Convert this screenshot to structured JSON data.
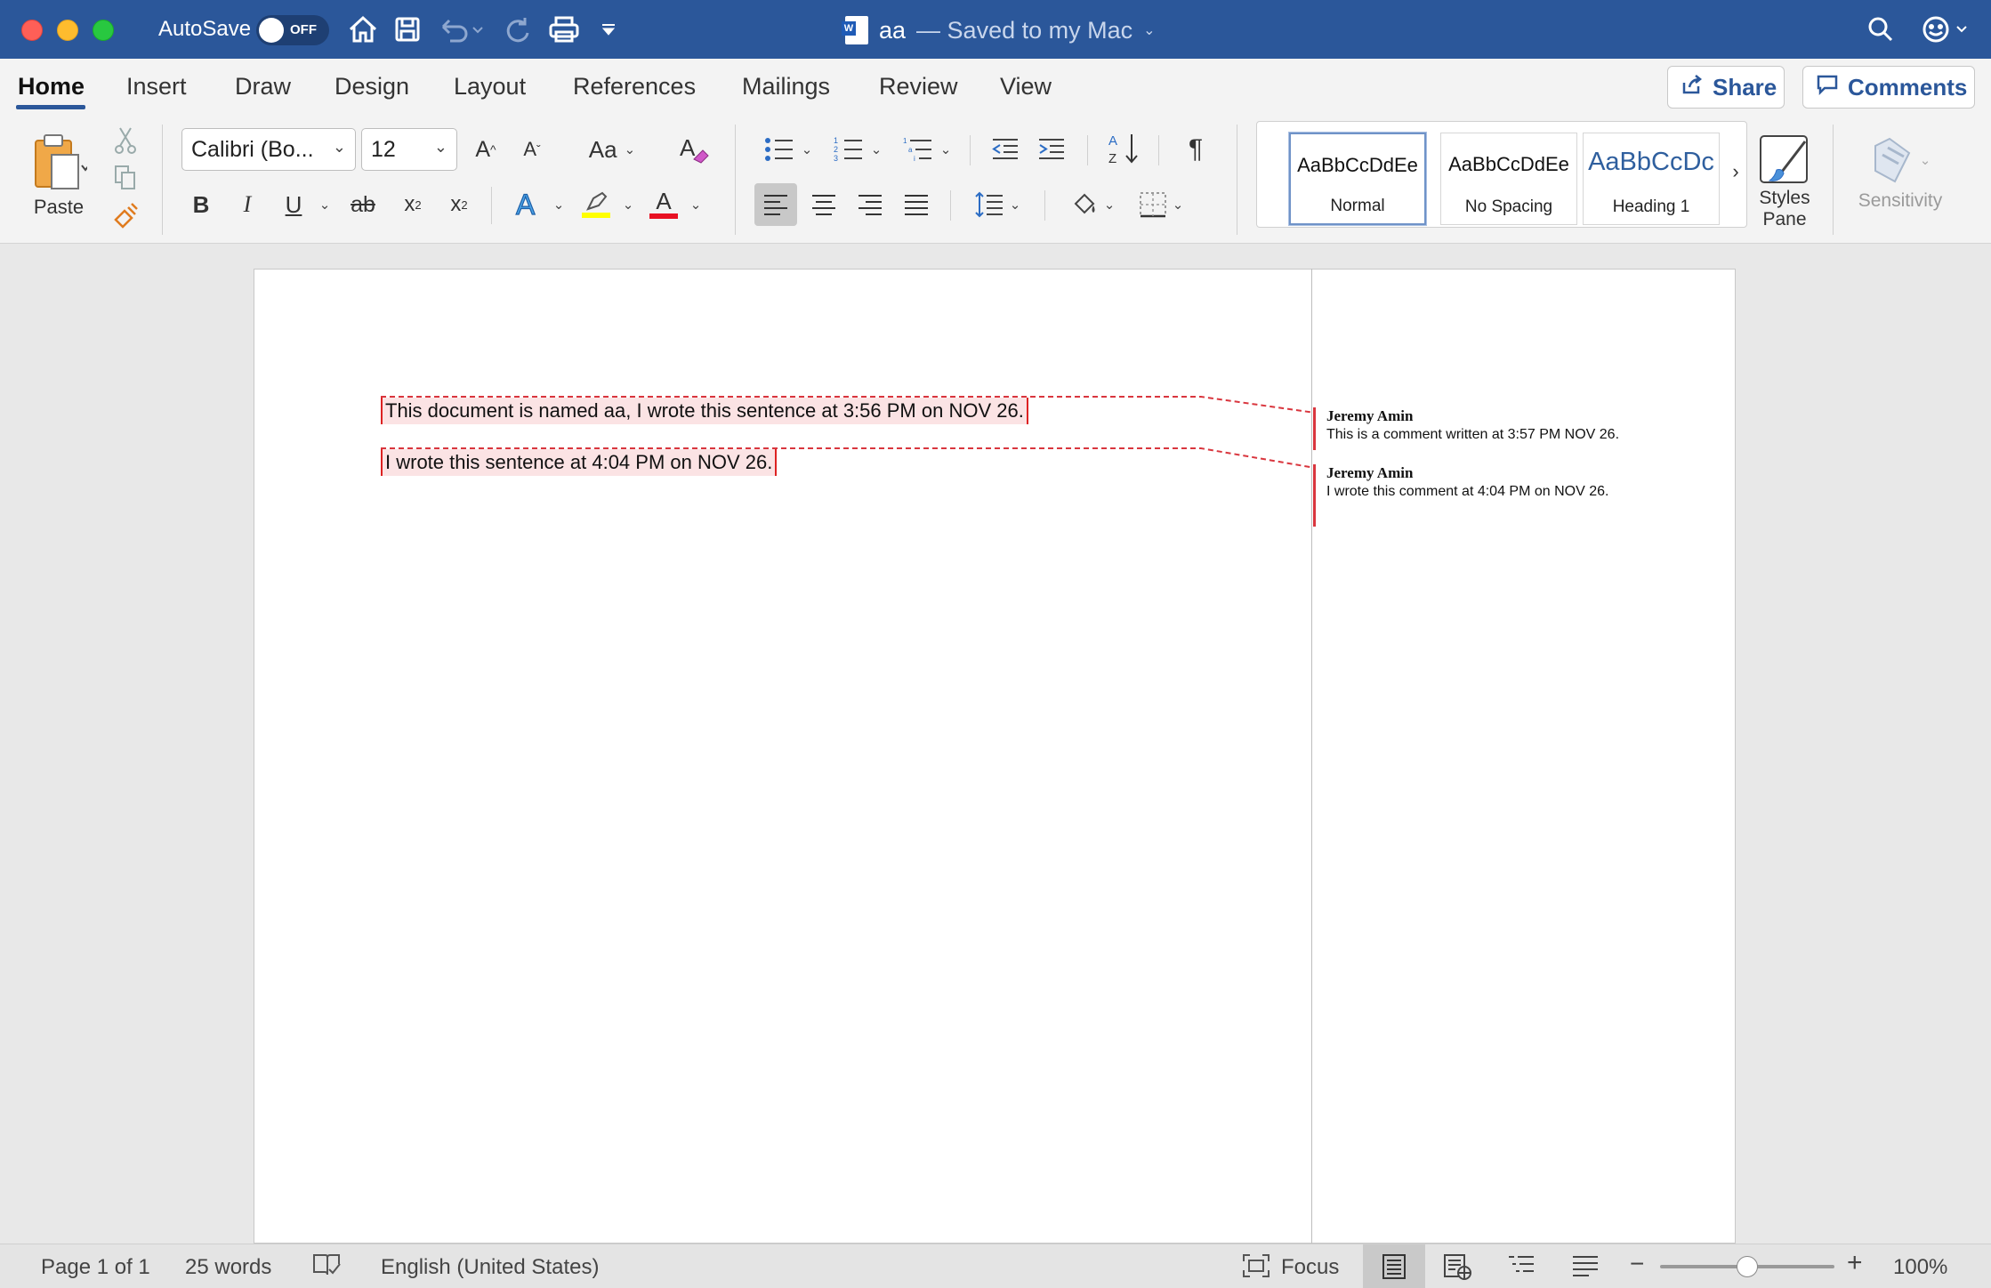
{
  "titlebar": {
    "autosave_label": "AutoSave",
    "autosave_state": "OFF",
    "doc_name": "aa",
    "doc_status": "— Saved to my Mac",
    "word_icon_letter": "W"
  },
  "tabs": [
    {
      "label": "Home",
      "active": true
    },
    {
      "label": "Insert"
    },
    {
      "label": "Draw"
    },
    {
      "label": "Design"
    },
    {
      "label": "Layout"
    },
    {
      "label": "References"
    },
    {
      "label": "Mailings"
    },
    {
      "label": "Review"
    },
    {
      "label": "View"
    }
  ],
  "header_buttons": {
    "share_label": "Share",
    "comments_label": "Comments"
  },
  "ribbon": {
    "paste_label": "Paste",
    "font_name": "Calibri (Bo...",
    "font_size": "12",
    "bold": "B",
    "italic": "I",
    "underline": "U",
    "strike": "ab",
    "change_case": "Aa",
    "highlight_color": "#ffff00",
    "font_color": "#e81123",
    "styles": [
      {
        "preview": "AaBbCcDdEe",
        "name": "Normal",
        "selected": true
      },
      {
        "preview": "AaBbCcDdEe",
        "name": "No Spacing"
      },
      {
        "preview": "AaBbCcDc",
        "name": "Heading 1"
      }
    ],
    "styles_pane_line1": "Styles",
    "styles_pane_line2": "Pane",
    "sensitivity_label": "Sensitivity"
  },
  "document": {
    "paragraphs": [
      "This document is named aa, I wrote this sentence at 3:56 PM on NOV 26.",
      "I wrote this sentence at 4:04 PM on NOV 26."
    ],
    "comments": [
      {
        "author": "Jeremy Amin",
        "text": "This is a comment written at 3:57 PM NOV 26."
      },
      {
        "author": "Jeremy Amin",
        "text": "I wrote this comment at 4:04 PM on NOV 26."
      }
    ]
  },
  "statusbar": {
    "page": "Page 1 of 1",
    "words": "25 words",
    "language": "English (United States)",
    "focus_label": "Focus",
    "zoom": "100%",
    "zoom_level": 1.0
  },
  "colors": {
    "title_bar": "#2b579a",
    "comment_bar": "#d9363e",
    "highlight_bg": "#fbe3e4"
  }
}
